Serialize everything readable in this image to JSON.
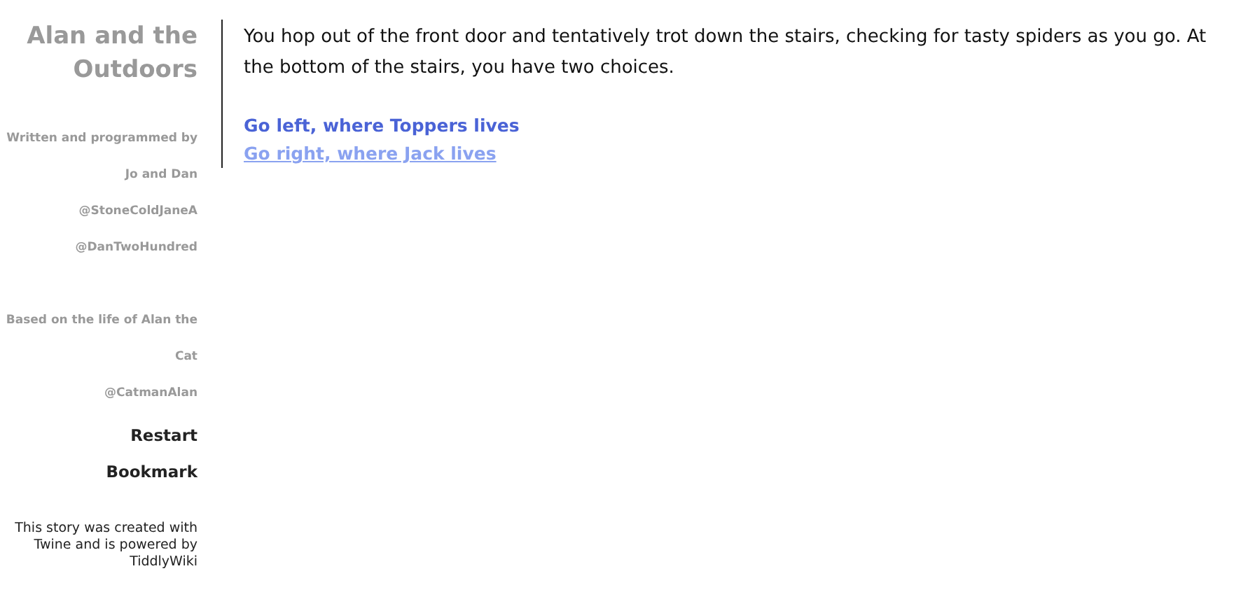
{
  "sidebar": {
    "title": "Alan and the Outdoors",
    "credits": [
      "Written and programmed by",
      "Jo and Dan",
      "@StoneColdJaneA",
      "@DanTwoHundred"
    ],
    "based_on": [
      "Based on the life of Alan the Cat",
      "@CatmanAlan"
    ],
    "menu": [
      "Restart",
      "Bookmark"
    ],
    "footer": "This story was created with Twine and is powered by TiddlyWiki"
  },
  "passage": {
    "text": "You hop out of the front door and tentatively trot down the stairs, checking for tasty spiders as you go. At the bottom of the stairs, you have two choices.",
    "links": [
      {
        "label": "Go left, where Toppers lives",
        "hovered": false
      },
      {
        "label": "Go right, where Jack lives",
        "hovered": true
      }
    ]
  }
}
